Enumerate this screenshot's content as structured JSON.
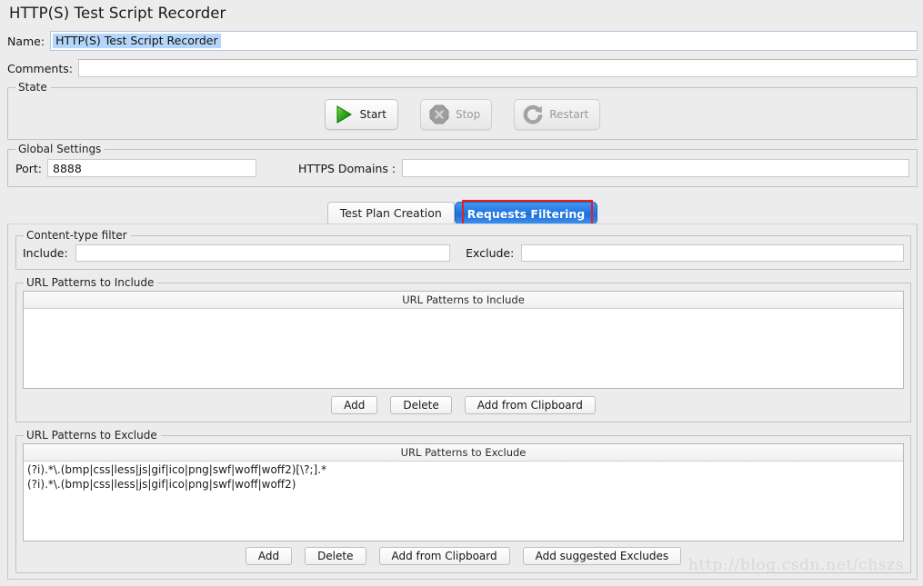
{
  "window": {
    "title": "HTTP(S) Test Script Recorder"
  },
  "fields": {
    "name_label": "Name:",
    "name_value": "HTTP(S) Test Script Recorder",
    "comments_label": "Comments:",
    "comments_value": ""
  },
  "state": {
    "group_title": "State",
    "buttons": [
      {
        "label": "Start",
        "icon": "play-icon",
        "enabled": true
      },
      {
        "label": "Stop",
        "icon": "stop-octagon-icon",
        "enabled": false
      },
      {
        "label": "Restart",
        "icon": "restart-arrow-icon",
        "enabled": false
      }
    ]
  },
  "global_settings": {
    "group_title": "Global Settings",
    "port_label": "Port:",
    "port_value": "8888",
    "https_label": "HTTPS Domains :",
    "https_value": ""
  },
  "tabs": {
    "items": [
      {
        "label": "Test Plan Creation",
        "active": false
      },
      {
        "label": "Requests Filtering",
        "active": true
      }
    ],
    "highlight_color": "#ee1c1c",
    "active_color": "#1b72e0"
  },
  "content_type_filter": {
    "group_title": "Content-type filter",
    "include_label": "Include:",
    "include_value": "",
    "exclude_label": "Exclude:",
    "exclude_value": ""
  },
  "url_include": {
    "group_title": "URL Patterns to Include",
    "column_header": "URL Patterns to Include",
    "rows": [],
    "buttons": [
      "Add",
      "Delete",
      "Add from Clipboard"
    ]
  },
  "url_exclude": {
    "group_title": "URL Patterns to Exclude",
    "column_header": "URL Patterns to Exclude",
    "rows": [
      "(?i).*\\.(bmp|css|less|js|gif|ico|png|swf|woff|woff2)[\\?;].*",
      "(?i).*\\.(bmp|css|less|js|gif|ico|png|swf|woff|woff2)"
    ],
    "buttons": [
      "Add",
      "Delete",
      "Add from Clipboard",
      "Add suggested Excludes"
    ]
  },
  "watermark": {
    "text": "http://blog.csdn.net/chszs"
  }
}
